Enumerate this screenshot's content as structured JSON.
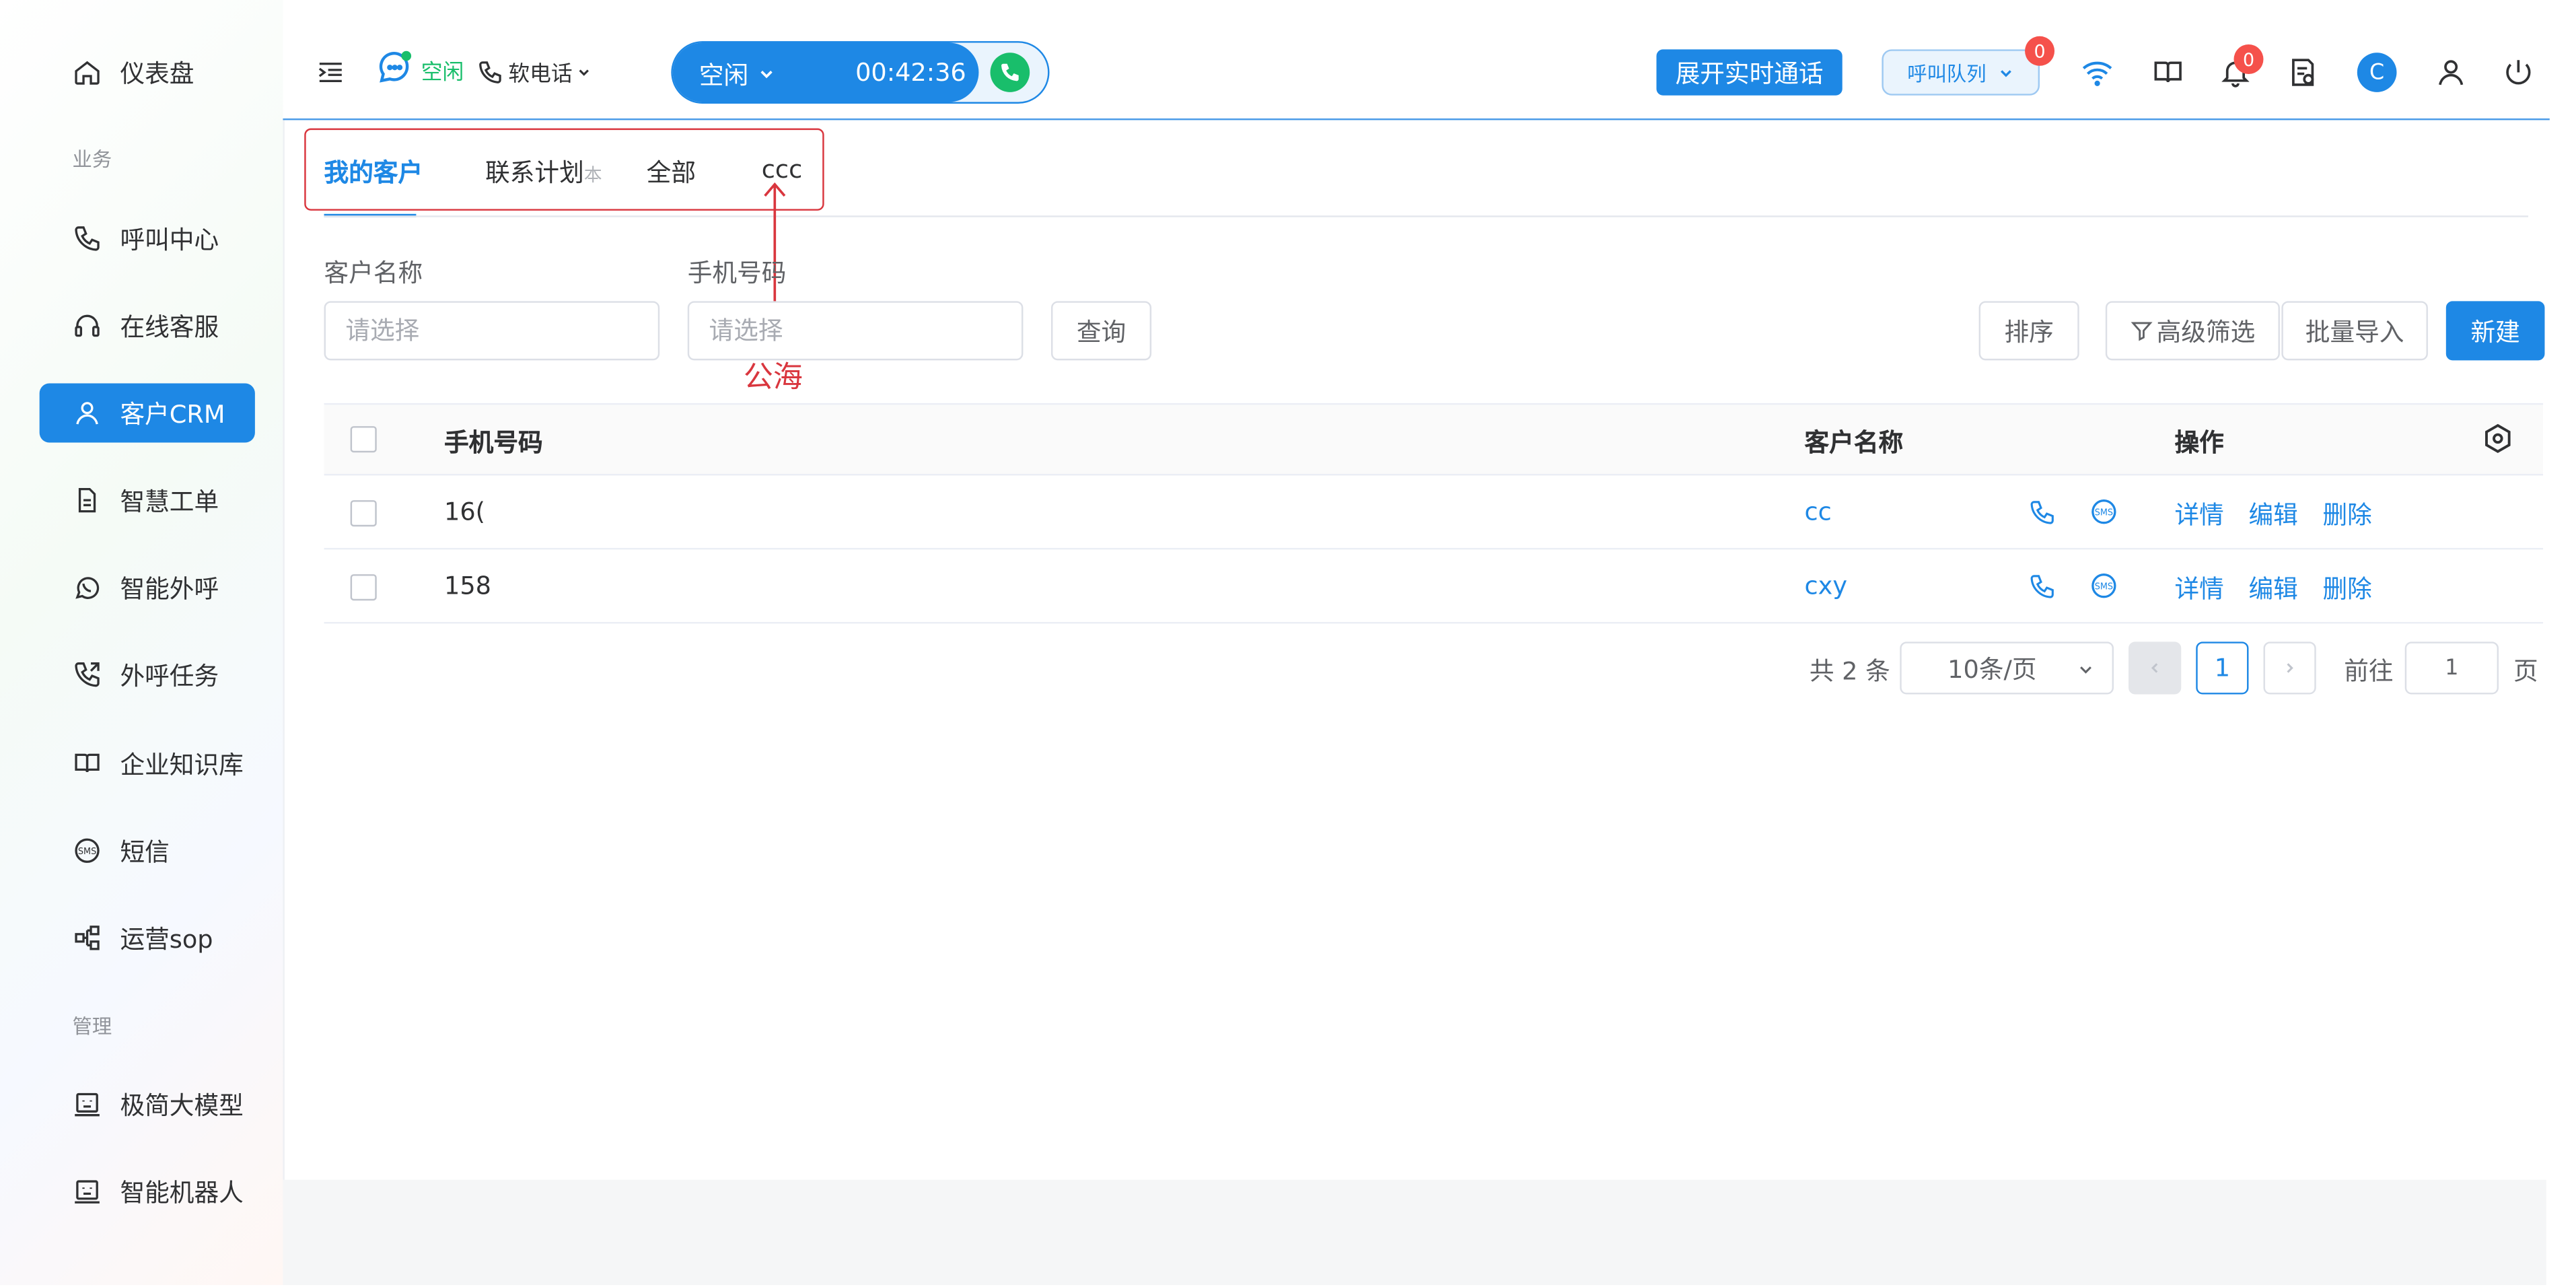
{
  "sidebar": {
    "items": [
      {
        "label": "仪表盘"
      },
      {
        "label": "呼叫中心"
      },
      {
        "label": "在线客服"
      },
      {
        "label": "客户CRM"
      },
      {
        "label": "智慧工单"
      },
      {
        "label": "智能外呼"
      },
      {
        "label": "外呼任务"
      },
      {
        "label": "企业知识库"
      },
      {
        "label": "短信"
      },
      {
        "label": "运营sop"
      },
      {
        "label": "极简大模型"
      },
      {
        "label": "智能机器人"
      }
    ],
    "groups": {
      "business": "业务",
      "manage": "管理"
    }
  },
  "header": {
    "agent_status": "空闲",
    "phone_mode": "软电话",
    "call_status": "空闲",
    "call_timer": "00:42:36",
    "expand_call_button": "展开实时通话",
    "queue_label": "呼叫队列",
    "queue_badge": "0",
    "notification_badge": "0",
    "avatar_letter": "C"
  },
  "tabs": [
    {
      "label": "我的客户",
      "active": true
    },
    {
      "label": "联系计划"
    },
    {
      "label": "全部"
    },
    {
      "label": "ccc"
    }
  ],
  "tab_hint": "本",
  "annotation": {
    "label": "公海",
    "color": "#d9363e"
  },
  "filters": {
    "customer_name": {
      "label": "客户名称",
      "placeholder": "请选择"
    },
    "phone": {
      "label": "手机号码",
      "placeholder": "请选择"
    },
    "query_button": "查询"
  },
  "toolbar": {
    "sort": "排序",
    "advanced_filter": "高级筛选",
    "batch_import": "批量导入",
    "create": "新建"
  },
  "table": {
    "columns": {
      "phone": "手机号码",
      "name": "客户名称",
      "actions": "操作"
    },
    "rows": [
      {
        "phone": "16(",
        "name": "cc"
      },
      {
        "phone": "158",
        "name": "cxy"
      }
    ],
    "row_actions": {
      "detail": "详情",
      "edit": "编辑",
      "delete": "删除"
    }
  },
  "pagination": {
    "total_text": "共 2 条",
    "page_size": "10条/页",
    "current_page": "1",
    "goto_label": "前往",
    "goto_value": "1",
    "page_suffix": "页"
  },
  "colors": {
    "primary": "#1e88e5",
    "badge": "#f5514b",
    "status_green": "#19be6b"
  }
}
